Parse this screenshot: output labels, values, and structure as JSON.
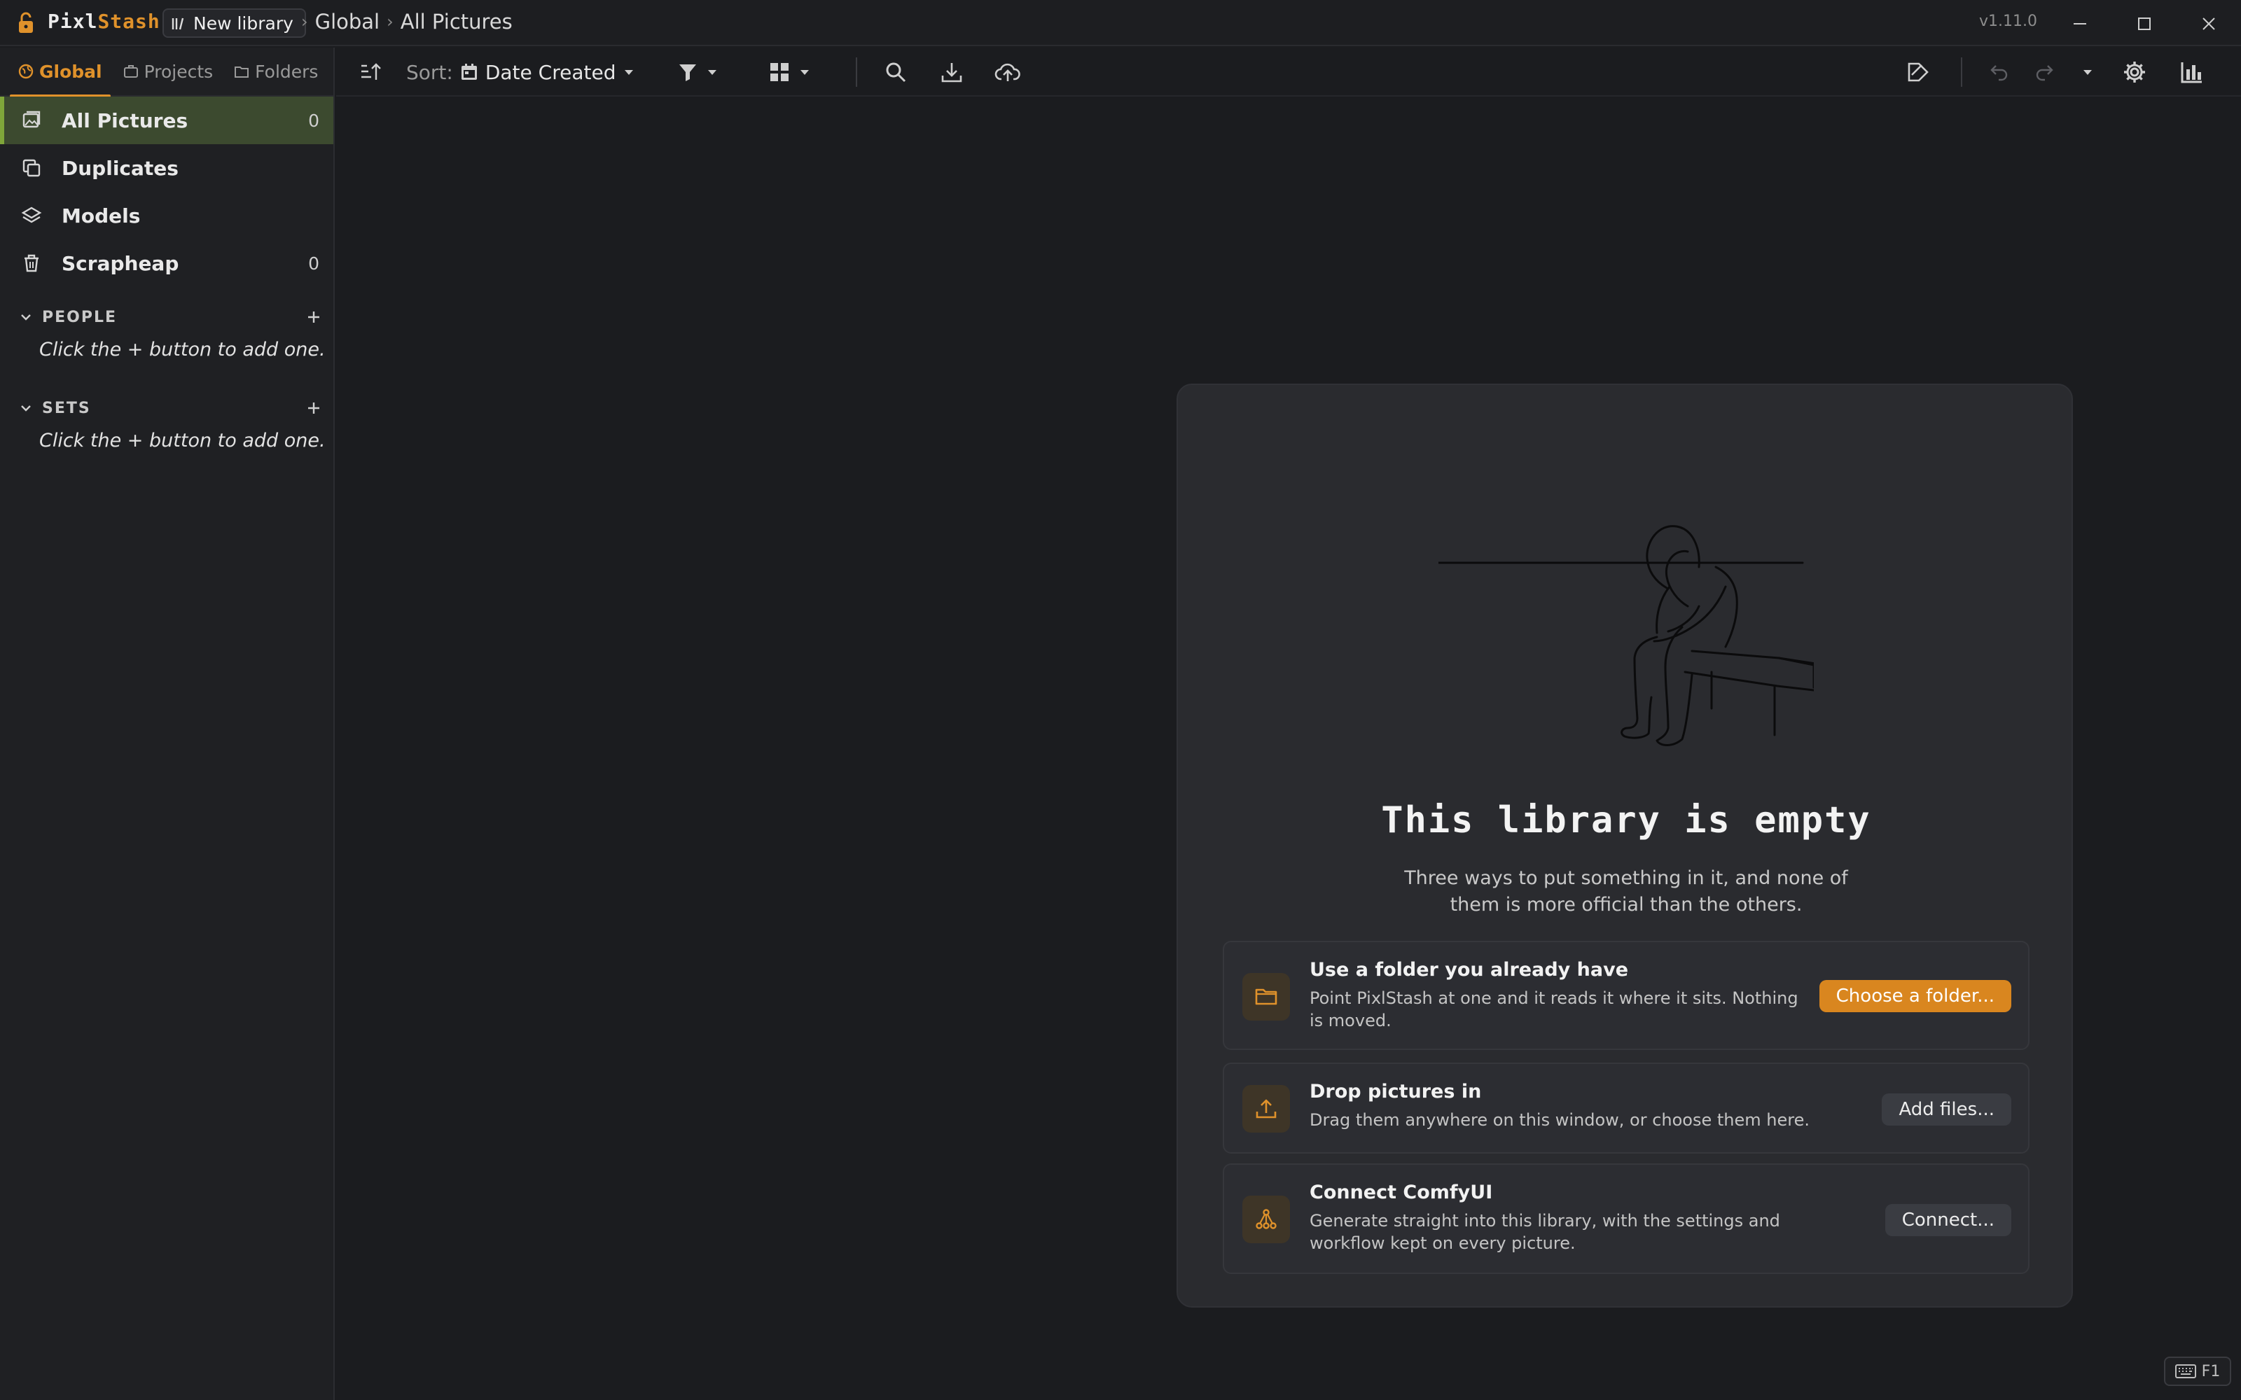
{
  "titlebar": {
    "app_name_prefix": "Pixl",
    "app_name_suffix": "Stash",
    "library_label": "New library",
    "breadcrumb": [
      "Global",
      "All Pictures"
    ],
    "version": "v1.11.0"
  },
  "sidebar": {
    "tabs": [
      {
        "label": "Global",
        "icon": "globe-icon",
        "active": true
      },
      {
        "label": "Projects",
        "icon": "briefcase-icon",
        "active": false
      },
      {
        "label": "Folders",
        "icon": "folder-icon",
        "active": false
      }
    ],
    "items": [
      {
        "label": "All Pictures",
        "count": "0",
        "icon": "pictures-icon",
        "active": true
      },
      {
        "label": "Duplicates",
        "count": "",
        "icon": "duplicates-icon",
        "active": false
      },
      {
        "label": "Models",
        "count": "",
        "icon": "layers-icon",
        "active": false
      },
      {
        "label": "Scrapheap",
        "count": "0",
        "icon": "trash-icon",
        "active": false
      }
    ],
    "sections": [
      {
        "title": "PEOPLE",
        "empty_text": "Click the + button to add one."
      },
      {
        "title": "SETS",
        "empty_text": "Click the + button to add one."
      }
    ]
  },
  "toolbar": {
    "sort_label": "Sort:",
    "sort_value": "Date Created"
  },
  "empty_state": {
    "title": "This library is empty",
    "subtitle": "Three ways to put something in it, and none of them is more official than the others.",
    "options": [
      {
        "title": "Use a folder you already have",
        "description": "Point PixlStash at one and it reads it where it sits. Nothing is moved.",
        "button": "Choose a folder...",
        "icon": "folder-icon"
      },
      {
        "title": "Drop pictures in",
        "description": "Drag them anywhere on this window, or choose them here.",
        "button": "Add files...",
        "icon": "upload-icon"
      },
      {
        "title": "Connect ComfyUI",
        "description": "Generate straight into this library, with the settings and workflow kept on every picture.",
        "button": "Connect...",
        "icon": "comfy-nodes-icon"
      }
    ]
  },
  "status": {
    "shortcut_key": "F1"
  },
  "colors": {
    "accent": "#e0922b",
    "active_nav_bg": "#3c4a2f",
    "background": "#1b1c1f",
    "card_bg": "#2a2b2f"
  }
}
